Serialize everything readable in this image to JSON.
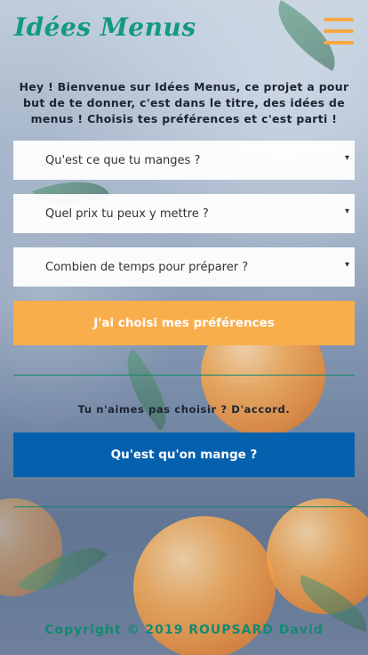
{
  "header": {
    "logo": "Idées Menus",
    "menu_icon": "hamburger-menu-icon"
  },
  "intro": {
    "text": "Hey ! Bienvenue sur Idées Menus, ce projet a pour but de te donner, c'est dans le titre, des idées de menus ! Choisis tes préférences et c'est parti !"
  },
  "form": {
    "selects": [
      {
        "placeholder": "Qu'est ce que tu manges ?"
      },
      {
        "placeholder": "Quel prix tu peux y mettre ?"
      },
      {
        "placeholder": "Combien de temps pour préparer ?"
      }
    ],
    "caret": "▾",
    "submit_label": "J'ai choisi mes préférences"
  },
  "random": {
    "text": "Tu n'aimes pas choisir ? D'accord.",
    "button_label": "Qu'est qu'on mange ?"
  },
  "footer": {
    "copyright": "Copyright © 2019 ROUPSARD David"
  },
  "colors": {
    "accent_green": "#129a7e",
    "accent_orange": "#f9ae4c",
    "accent_blue": "#0561ae"
  }
}
